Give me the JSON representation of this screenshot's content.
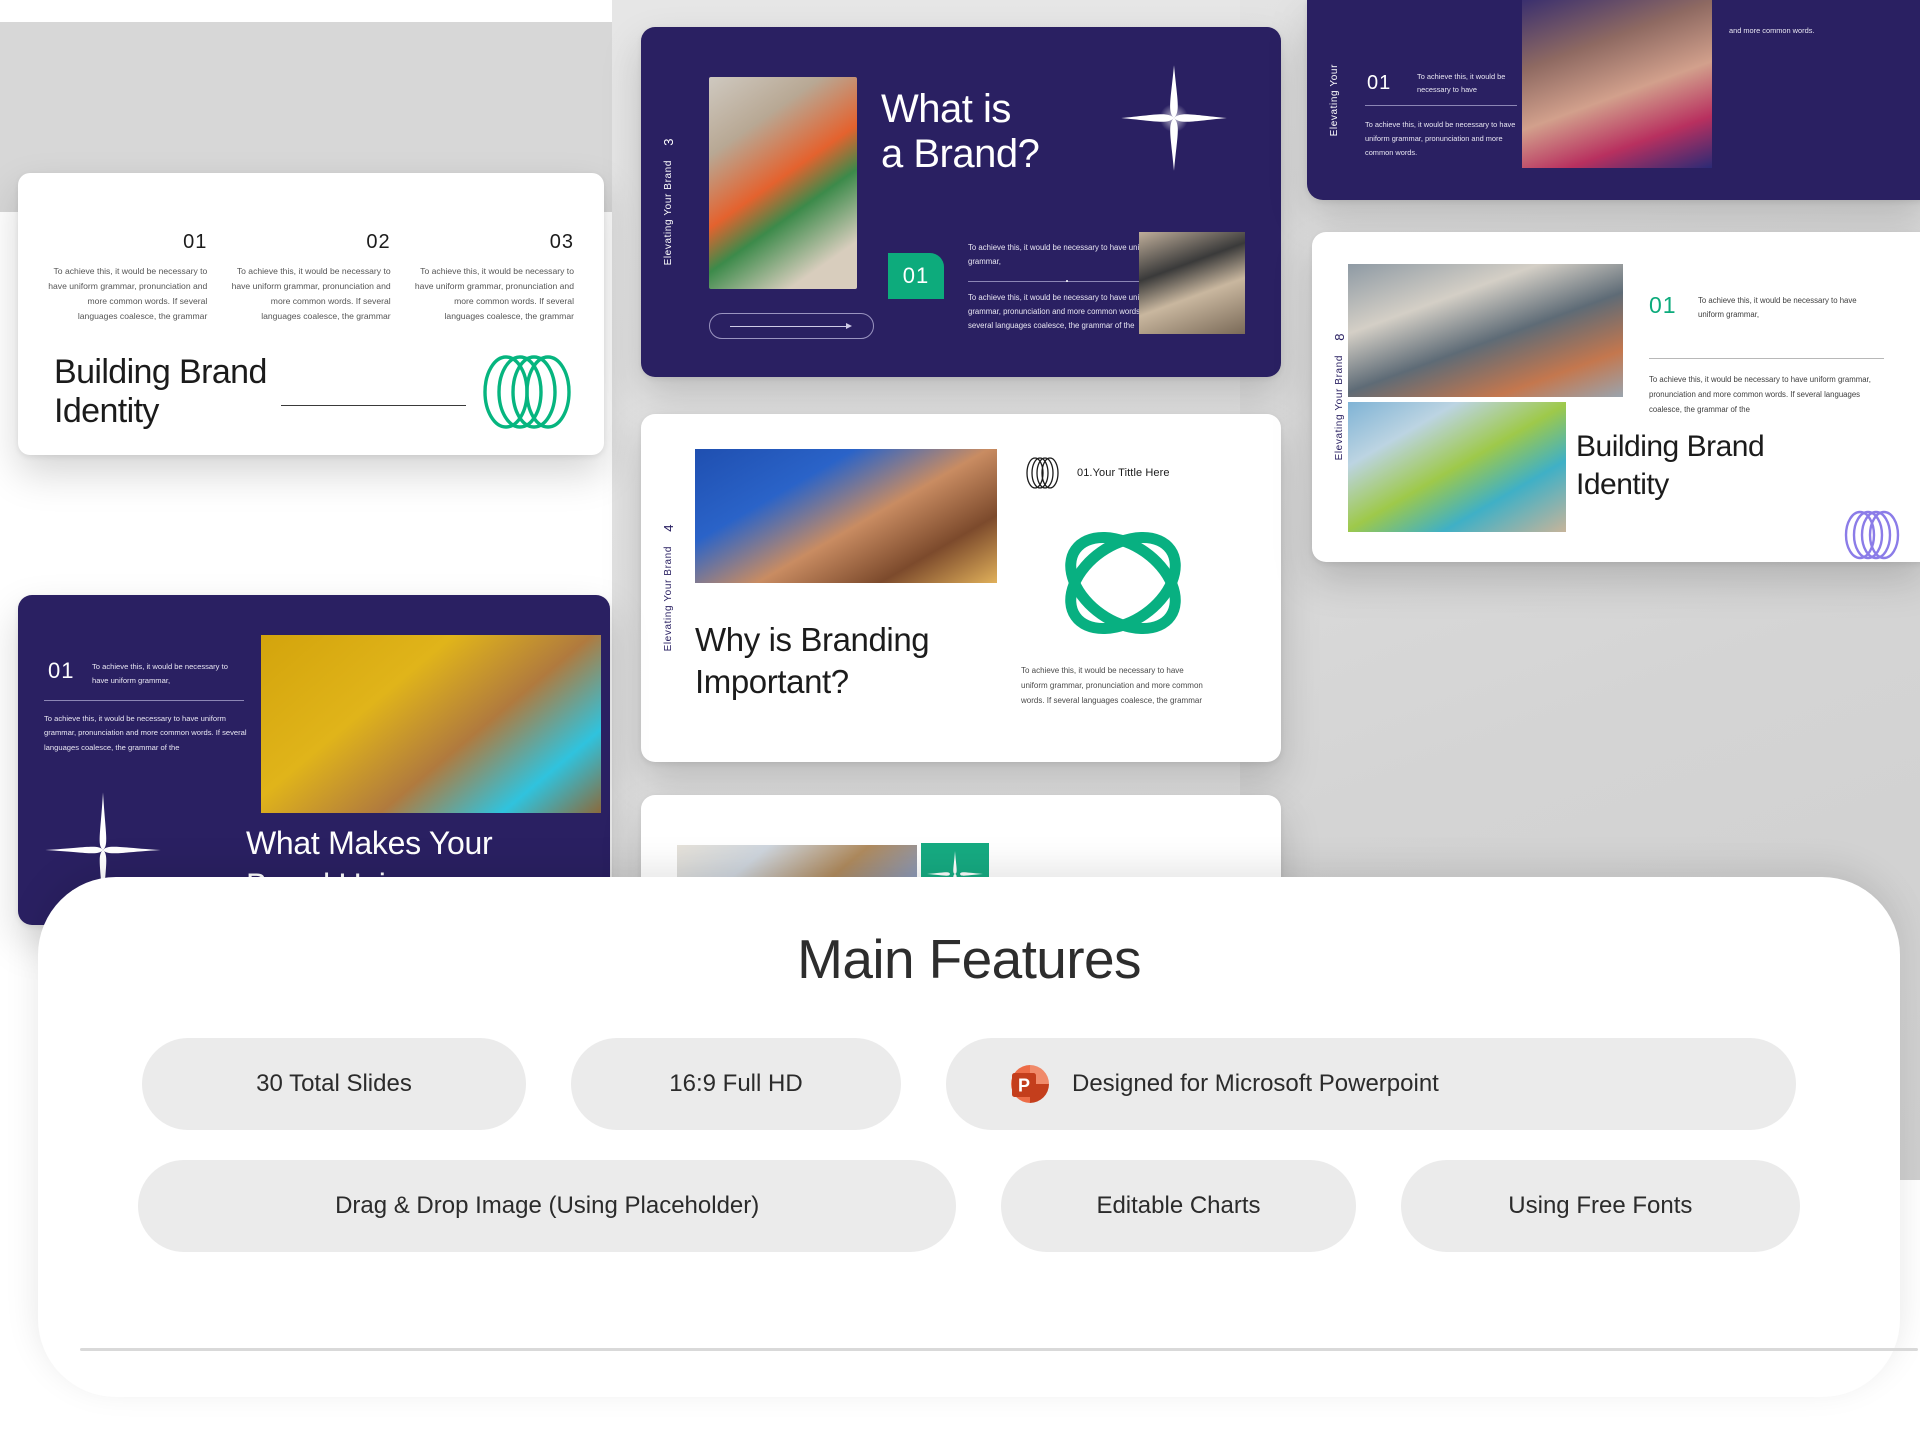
{
  "backdrop": {
    "bg_color": "#ffffff",
    "gray": "#d7d7d7"
  },
  "theme": {
    "dark_purple": "#2a2062",
    "green": "#0dab7c",
    "green_alt": "#16ab82",
    "lavender": "#8b7ce8",
    "pill_bg": "#ebebeb",
    "powerpoint_orange": "#d24726"
  },
  "common": {
    "body_short": "To achieve this, it would be necessary to have uniform grammar,",
    "body_long": "To achieve this, it would be necessary to have uniform grammar, pronunciation and more common words. If several languages coalesce, the grammar of the",
    "body_col": "To achieve this, it would be necessary to have uniform grammar, pronunciation and more common words. If several languages coalesce, the grammar",
    "body_wrapped": "To achieve this, it would be necessary to have uniform grammar, pronunciation and more common words.",
    "body_tail": "and more common words.",
    "brand_rail": "Elevating Your Brand"
  },
  "slides": {
    "columns_slide": {
      "name": "Building Brand Identity overview",
      "columns": [
        {
          "number": "01",
          "text": "To achieve this, it would be necessary to have uniform grammar, pronunciation and more common words. If several languages coalesce, the grammar"
        },
        {
          "number": "02",
          "text": "To achieve this, it would be necessary to have uniform grammar, pronunciation and more common words. If several languages coalesce, the grammar"
        },
        {
          "number": "03",
          "text": "To achieve this, it would be necessary to have uniform grammar, pronunciation and more common words. If several languages coalesce, the grammar"
        }
      ],
      "title_line1": "Building Brand",
      "title_line2": "Identity",
      "logo": "overlapping-circles-logo"
    },
    "what_is_a_brand": {
      "rail_text": "Elevating Your Brand",
      "slide_number": "3",
      "title_line1": "What is",
      "title_line2": "a Brand?",
      "badge_number": "01",
      "text_top": "To achieve this, it would be necessary to have uniform grammar,",
      "text_bottom": "To achieve this, it would be necessary to have uniform grammar, pronunciation and more common words. If several languages coalesce, the grammar of the",
      "sparkle": "four-point-star",
      "arrow_button": "arrow-right"
    },
    "why_branding": {
      "rail_text": "Elevating Your Brand",
      "slide_number": "4",
      "title_line1": "Why is Branding",
      "title_line2": "Important?",
      "subtitle": "01.Your Tittle Here",
      "body": "To achieve this, it would be necessary to have uniform grammar, pronunciation and more common words. If several languages coalesce, the grammar",
      "logo": "orbit-rings-logo"
    },
    "top_right_dark": {
      "rail_text": "Elevating Your",
      "badge_number": "01",
      "text_top": "To achieve this, it would be necessary to have",
      "text_bottom": "To achieve this, it would be necessary to have uniform grammar, pronunciation and more common words.",
      "text_right": "and more common words."
    },
    "building_brand_right": {
      "rail_text": "Elevating Your Brand",
      "slide_number": "8",
      "badge_number": "01",
      "text_top": "To achieve this, it would be necessary to have uniform grammar,",
      "text_bottom": "To achieve this, it would be necessary to have uniform grammar, pronunciation and more common words. If several languages coalesce, the grammar of the",
      "title_line1": "Building Brand",
      "title_line2": "Identity",
      "logo": "overlapping-circles-logo-lavender"
    },
    "what_makes_unique": {
      "badge_number": "01",
      "text_top": "To achieve this, it would be necessary to have uniform grammar,",
      "text_bottom": "To achieve this, it would be necessary to have uniform grammar, pronunciation and more common words. If several languages coalesce, the grammar of the",
      "title_line1": "What Makes Your",
      "title_line2": "Brand Unique",
      "sparkle": "four-point-star"
    },
    "bottom_center": {
      "accent_square": "green-sparkle-square"
    }
  },
  "features_panel": {
    "title": "Main Features",
    "row1": [
      {
        "label": "30 Total Slides",
        "icon": null
      },
      {
        "label": "16:9 Full HD",
        "icon": null
      },
      {
        "label": "Designed for Microsoft Powerpoint",
        "icon": "powerpoint-icon"
      }
    ],
    "row2": [
      {
        "label": "Drag & Drop Image (Using Placeholder)",
        "icon": null
      },
      {
        "label": "Editable Charts",
        "icon": null
      },
      {
        "label": "Using Free Fonts",
        "icon": null
      }
    ]
  }
}
